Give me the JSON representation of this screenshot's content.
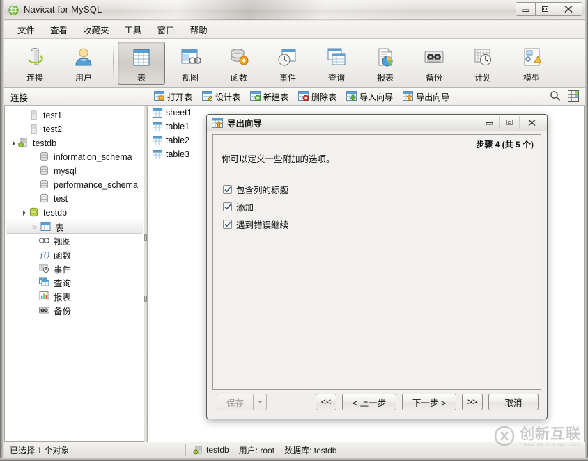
{
  "window": {
    "title": "Navicat for MySQL",
    "app_icon": "navicat-globe-icon",
    "controls": {
      "minimize": "—",
      "maximize": "□",
      "close": "✕"
    }
  },
  "menubar": {
    "items": [
      {
        "label": "文件",
        "name": "menu-file"
      },
      {
        "label": "查看",
        "name": "menu-view"
      },
      {
        "label": "收藏夹",
        "name": "menu-favorites"
      },
      {
        "label": "工具",
        "name": "menu-tools"
      },
      {
        "label": "窗口",
        "name": "menu-window"
      },
      {
        "label": "帮助",
        "name": "menu-help"
      }
    ]
  },
  "toolbar": {
    "buttons": [
      {
        "label": "连接",
        "icon": "connection-icon",
        "selected": false
      },
      {
        "label": "用户",
        "icon": "user-icon",
        "selected": false
      },
      {
        "label": "表",
        "icon": "table-icon",
        "selected": true
      },
      {
        "label": "视图",
        "icon": "view-icon",
        "selected": false
      },
      {
        "label": "函数",
        "icon": "function-icon",
        "selected": false
      },
      {
        "label": "事件",
        "icon": "event-icon",
        "selected": false
      },
      {
        "label": "查询",
        "icon": "query-icon",
        "selected": false
      },
      {
        "label": "报表",
        "icon": "report-icon",
        "selected": false
      },
      {
        "label": "备份",
        "icon": "backup-icon",
        "selected": false
      },
      {
        "label": "计划",
        "icon": "schedule-icon",
        "selected": false
      },
      {
        "label": "模型",
        "icon": "model-icon",
        "selected": false
      }
    ]
  },
  "subtoolbar": {
    "buttons": [
      {
        "label": "打开表",
        "icon": "open-table-icon"
      },
      {
        "label": "设计表",
        "icon": "design-table-icon"
      },
      {
        "label": "新建表",
        "icon": "new-table-icon"
      },
      {
        "label": "删除表",
        "icon": "delete-table-icon"
      },
      {
        "label": "导入向导",
        "icon": "import-wizard-icon"
      },
      {
        "label": "导出向导",
        "icon": "export-wizard-icon"
      }
    ],
    "right_icons": [
      {
        "name": "search-icon"
      },
      {
        "name": "grid-view-icon"
      }
    ]
  },
  "sidebar": {
    "header": "连接",
    "tree": [
      {
        "label": "test1",
        "icon": "server-offline-icon",
        "indent": 1,
        "expander": "",
        "selected": false
      },
      {
        "label": "test2",
        "icon": "server-offline-icon",
        "indent": 1,
        "expander": "",
        "selected": false
      },
      {
        "label": "testdb",
        "icon": "server-online-icon",
        "indent": 0,
        "expander": "open",
        "selected": false
      },
      {
        "label": "information_schema",
        "icon": "database-icon",
        "indent": 2,
        "expander": "",
        "selected": false
      },
      {
        "label": "mysql",
        "icon": "database-icon",
        "indent": 2,
        "expander": "",
        "selected": false
      },
      {
        "label": "performance_schema",
        "icon": "database-icon",
        "indent": 2,
        "expander": "",
        "selected": false
      },
      {
        "label": "test",
        "icon": "database-icon",
        "indent": 2,
        "expander": "",
        "selected": false
      },
      {
        "label": "testdb",
        "icon": "database-open-icon",
        "indent": 1,
        "expander": "open",
        "selected": false
      },
      {
        "label": "表",
        "icon": "table-folder-icon",
        "indent": 2,
        "expander": "closed",
        "selected": true
      },
      {
        "label": "视图",
        "icon": "views-icon",
        "indent": 2,
        "expander": "",
        "selected": false
      },
      {
        "label": "函数",
        "icon": "functions-icon",
        "indent": 2,
        "expander": "",
        "selected": false
      },
      {
        "label": "事件",
        "icon": "events-icon",
        "indent": 2,
        "expander": "",
        "selected": false
      },
      {
        "label": "查询",
        "icon": "queries-icon",
        "indent": 2,
        "expander": "",
        "selected": false
      },
      {
        "label": "报表",
        "icon": "reports-icon",
        "indent": 2,
        "expander": "",
        "selected": false
      },
      {
        "label": "备份",
        "icon": "backups-icon",
        "indent": 2,
        "expander": "",
        "selected": false
      }
    ]
  },
  "objectlist": {
    "items": [
      {
        "label": "sheet1",
        "icon": "table-icon"
      },
      {
        "label": "table1",
        "icon": "table-icon"
      },
      {
        "label": "table2",
        "icon": "table-icon"
      },
      {
        "label": "table3",
        "icon": "table-icon"
      }
    ]
  },
  "statusbar": {
    "selection": "已选择 1 个对象",
    "connection": "testdb",
    "user": "用户: root",
    "database": "数据库: testdb",
    "connection_icon": "server-online-icon"
  },
  "dialog": {
    "title": "导出向导",
    "icon": "export-wizard-icon",
    "controls": {
      "minimize": "—",
      "maximize": "□",
      "close": "✕"
    },
    "step_label": "步骤 4 (共 5 个)",
    "description": "你可以定义一些附加的选项。",
    "checkboxes": [
      {
        "label": "包含列的标题",
        "checked": true
      },
      {
        "label": "添加",
        "checked": true
      },
      {
        "label": "遇到错误继续",
        "checked": true
      }
    ],
    "footer": {
      "save": "保存",
      "save_disabled": true,
      "save_arrow": "▼",
      "first": "<<",
      "prev": "< 上一步",
      "next": "下一步 >",
      "last": ">>",
      "cancel": "取消"
    }
  },
  "watermark": {
    "cn": "创新互联",
    "en": "CHUANG XIN HU LIAN",
    "logo": "cx-logo-icon"
  },
  "colors": {
    "accent_blue": "#4a90c4",
    "selected_border": "#7f7c77",
    "window_bg": "#e8e6e1",
    "dialog_bg": "#f0efed"
  }
}
